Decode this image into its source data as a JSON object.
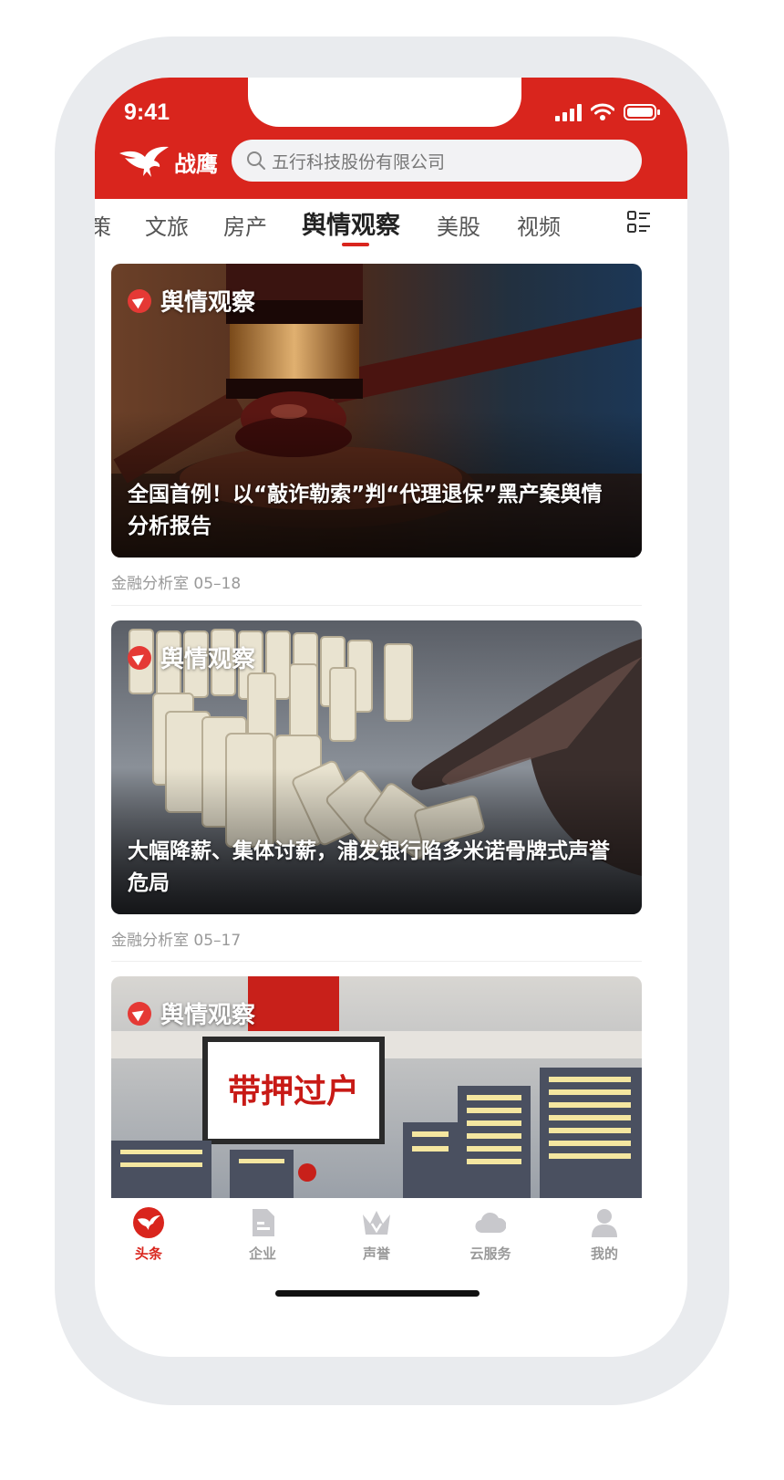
{
  "status_bar": {
    "time": "9:41"
  },
  "header": {
    "app_name": "战鹰",
    "search_placeholder": "五行科技股份有限公司",
    "accent_color": "#d9251d"
  },
  "tabs": [
    {
      "label": "策"
    },
    {
      "label": "文旅"
    },
    {
      "label": "房产"
    },
    {
      "label": "舆情观察",
      "active": true
    },
    {
      "label": "美股"
    },
    {
      "label": "视频"
    }
  ],
  "articles": [
    {
      "tag": "舆情观察",
      "title": "全国首例！以“敲诈勒索”判“代理退保”黑产案舆情分析报告",
      "source_date": "金融分析室 05–18"
    },
    {
      "tag": "舆情观察",
      "title": "大幅降薪、集体讨薪，浦发银行陷多米诺骨牌式声誉危局",
      "source_date": "金融分析室 05–17"
    },
    {
      "tag": "舆情观察",
      "image_caption": "带押过户"
    }
  ],
  "bottom_nav": [
    {
      "label": "头条",
      "icon": "eagle-icon",
      "active": true
    },
    {
      "label": "企业",
      "icon": "document-icon"
    },
    {
      "label": "声誉",
      "icon": "crown-icon"
    },
    {
      "label": "云服务",
      "icon": "cloud-icon"
    },
    {
      "label": "我的",
      "icon": "person-icon"
    }
  ]
}
